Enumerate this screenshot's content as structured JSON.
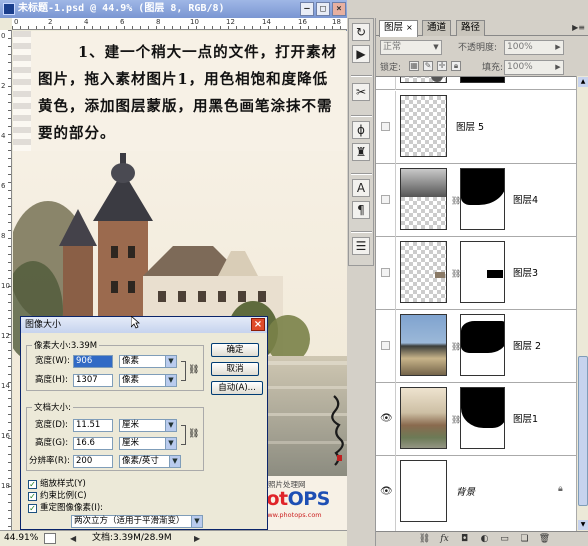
{
  "document": {
    "title": "未标题-1.psd @ 44.9% (图层 8, RGB/8)",
    "ruler_h_numbers": [
      "0",
      "2",
      "4",
      "6",
      "8",
      "10",
      "12",
      "14",
      "16",
      "18"
    ],
    "ruler_v_numbers": [
      "0",
      "2",
      "4",
      "6",
      "8",
      "10",
      "12",
      "14",
      "16",
      "18"
    ],
    "instruction_text": "1、建一个稍大一点的文件，打开素材图片，拖入素材图片1，用色相饱和度降低黄色，添加图层蒙版，用黑色画笔涂抹不需要的部分。"
  },
  "status_bar": {
    "zoom": "44.91%",
    "doc_info": "文档:3.39M/28.9M"
  },
  "dialog": {
    "title": "图像大小",
    "pixel_group": {
      "legend": "像素大小:3.39M",
      "width_label": "宽度(W):",
      "width_value": "906",
      "width_unit": "像素",
      "height_label": "高度(H):",
      "height_value": "1307",
      "height_unit": "像素"
    },
    "doc_group": {
      "legend": "文档大小:",
      "width_label": "宽度(D):",
      "width_value": "11.51",
      "width_unit": "厘米",
      "height_label": "高度(G):",
      "height_value": "16.6",
      "height_unit": "厘米",
      "res_label": "分辨率(R):",
      "res_value": "200",
      "res_unit": "像素/英寸"
    },
    "buttons": {
      "ok": "确定",
      "cancel": "取消",
      "auto": "自动(A)..."
    },
    "checkboxes": {
      "scale_styles": "缩放样式(Y)",
      "constrain": "约束比例(C)",
      "resample": "重定图像像素(I):"
    },
    "resample_method": "两次立方（适用于平滑渐变）"
  },
  "tools": {
    "icons": [
      "history-brush-icon",
      "action-play-icon",
      "tools-icon",
      "brush-preset-icon",
      "clone-stamp-icon",
      "character-icon",
      "paragraph-icon",
      "layer-comps-icon"
    ]
  },
  "layers_panel": {
    "tabs": [
      "图层",
      "通道",
      "路径"
    ],
    "blend_mode": "正常",
    "opacity_label": "不透明度:",
    "opacity_value": "100%",
    "lock_label": "锁定:",
    "fill_label": "填充:",
    "fill_value": "100%",
    "layers": [
      {
        "name": "图层 5",
        "visible": false,
        "has_mask": false
      },
      {
        "name": "图层4",
        "visible": false,
        "has_mask": true
      },
      {
        "name": "图层3",
        "visible": false,
        "has_mask": true
      },
      {
        "name": "图层 2",
        "visible": false,
        "has_mask": true
      },
      {
        "name": "图层1",
        "visible": true,
        "has_mask": true
      },
      {
        "name": "背景",
        "visible": true,
        "has_mask": false
      }
    ],
    "bottom_icons": [
      "link-layers-icon",
      "fx-icon",
      "add-mask-icon",
      "adjustment-icon",
      "group-icon",
      "new-layer-icon",
      "trash-icon"
    ]
  },
  "watermark": {
    "small_text": "照片处理网",
    "brand_part1": "Phot",
    "brand_part2": "OPS",
    "url": "www.photops.com"
  },
  "colors": {
    "titlebar": "#7a96d2",
    "dialog_border": "#0a246a",
    "selection": "#316ac5",
    "brand_red": "#e0242a",
    "brand_blue": "#1e4fb4"
  }
}
